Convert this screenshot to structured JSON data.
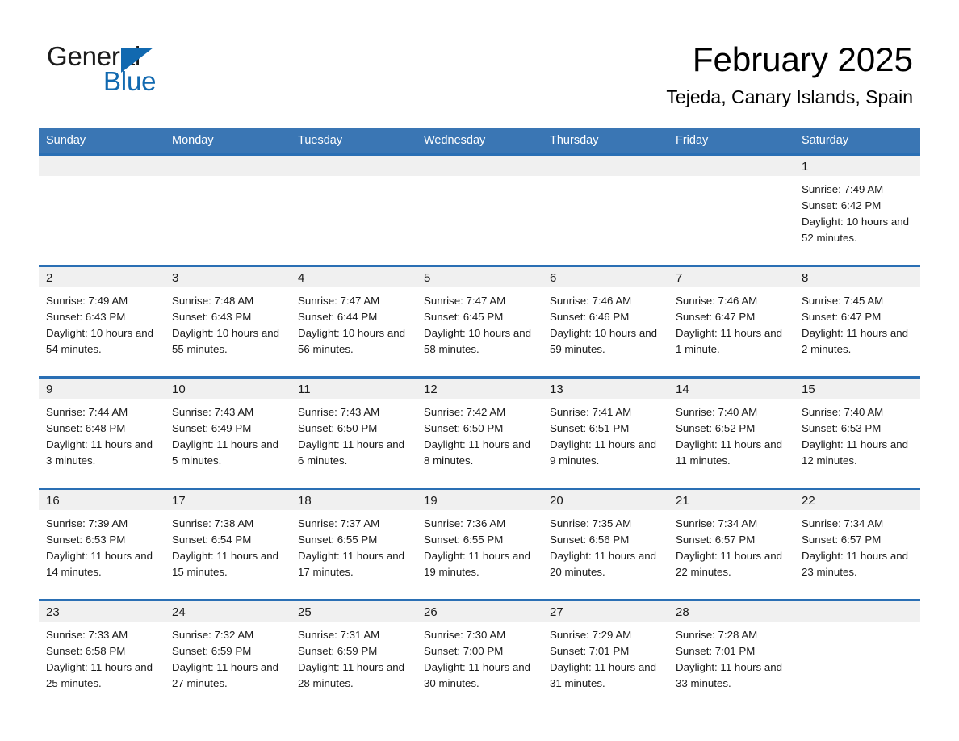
{
  "brand": {
    "name_part1": "General",
    "name_part2": "Blue",
    "triangle_icon": "blue-triangle-logo-mark",
    "accent_color": "#1169b0"
  },
  "header": {
    "month_title": "February 2025",
    "location": "Tejeda, Canary Islands, Spain"
  },
  "theme": {
    "header_blue": "#3a76b4",
    "row_divider_blue": "#2a6fb4",
    "daynum_band_gray": "#f0f0f0",
    "page_background": "#ffffff",
    "text_color": "#1a1a1a"
  },
  "calendar": {
    "weekday_headers": [
      "Sunday",
      "Monday",
      "Tuesday",
      "Wednesday",
      "Thursday",
      "Friday",
      "Saturday"
    ],
    "labels": {
      "sunrise": "Sunrise:",
      "sunset": "Sunset:",
      "daylight": "Daylight:"
    },
    "weeks": [
      [
        {
          "day": ""
        },
        {
          "day": ""
        },
        {
          "day": ""
        },
        {
          "day": ""
        },
        {
          "day": ""
        },
        {
          "day": ""
        },
        {
          "day": "1",
          "sunrise": "Sunrise: 7:49 AM",
          "sunset": "Sunset: 6:42 PM",
          "daylight": "Daylight: 10 hours and 52 minutes."
        }
      ],
      [
        {
          "day": "2",
          "sunrise": "Sunrise: 7:49 AM",
          "sunset": "Sunset: 6:43 PM",
          "daylight": "Daylight: 10 hours and 54 minutes."
        },
        {
          "day": "3",
          "sunrise": "Sunrise: 7:48 AM",
          "sunset": "Sunset: 6:43 PM",
          "daylight": "Daylight: 10 hours and 55 minutes."
        },
        {
          "day": "4",
          "sunrise": "Sunrise: 7:47 AM",
          "sunset": "Sunset: 6:44 PM",
          "daylight": "Daylight: 10 hours and 56 minutes."
        },
        {
          "day": "5",
          "sunrise": "Sunrise: 7:47 AM",
          "sunset": "Sunset: 6:45 PM",
          "daylight": "Daylight: 10 hours and 58 minutes."
        },
        {
          "day": "6",
          "sunrise": "Sunrise: 7:46 AM",
          "sunset": "Sunset: 6:46 PM",
          "daylight": "Daylight: 10 hours and 59 minutes."
        },
        {
          "day": "7",
          "sunrise": "Sunrise: 7:46 AM",
          "sunset": "Sunset: 6:47 PM",
          "daylight": "Daylight: 11 hours and 1 minute."
        },
        {
          "day": "8",
          "sunrise": "Sunrise: 7:45 AM",
          "sunset": "Sunset: 6:47 PM",
          "daylight": "Daylight: 11 hours and 2 minutes."
        }
      ],
      [
        {
          "day": "9",
          "sunrise": "Sunrise: 7:44 AM",
          "sunset": "Sunset: 6:48 PM",
          "daylight": "Daylight: 11 hours and 3 minutes."
        },
        {
          "day": "10",
          "sunrise": "Sunrise: 7:43 AM",
          "sunset": "Sunset: 6:49 PM",
          "daylight": "Daylight: 11 hours and 5 minutes."
        },
        {
          "day": "11",
          "sunrise": "Sunrise: 7:43 AM",
          "sunset": "Sunset: 6:50 PM",
          "daylight": "Daylight: 11 hours and 6 minutes."
        },
        {
          "day": "12",
          "sunrise": "Sunrise: 7:42 AM",
          "sunset": "Sunset: 6:50 PM",
          "daylight": "Daylight: 11 hours and 8 minutes."
        },
        {
          "day": "13",
          "sunrise": "Sunrise: 7:41 AM",
          "sunset": "Sunset: 6:51 PM",
          "daylight": "Daylight: 11 hours and 9 minutes."
        },
        {
          "day": "14",
          "sunrise": "Sunrise: 7:40 AM",
          "sunset": "Sunset: 6:52 PM",
          "daylight": "Daylight: 11 hours and 11 minutes."
        },
        {
          "day": "15",
          "sunrise": "Sunrise: 7:40 AM",
          "sunset": "Sunset: 6:53 PM",
          "daylight": "Daylight: 11 hours and 12 minutes."
        }
      ],
      [
        {
          "day": "16",
          "sunrise": "Sunrise: 7:39 AM",
          "sunset": "Sunset: 6:53 PM",
          "daylight": "Daylight: 11 hours and 14 minutes."
        },
        {
          "day": "17",
          "sunrise": "Sunrise: 7:38 AM",
          "sunset": "Sunset: 6:54 PM",
          "daylight": "Daylight: 11 hours and 15 minutes."
        },
        {
          "day": "18",
          "sunrise": "Sunrise: 7:37 AM",
          "sunset": "Sunset: 6:55 PM",
          "daylight": "Daylight: 11 hours and 17 minutes."
        },
        {
          "day": "19",
          "sunrise": "Sunrise: 7:36 AM",
          "sunset": "Sunset: 6:55 PM",
          "daylight": "Daylight: 11 hours and 19 minutes."
        },
        {
          "day": "20",
          "sunrise": "Sunrise: 7:35 AM",
          "sunset": "Sunset: 6:56 PM",
          "daylight": "Daylight: 11 hours and 20 minutes."
        },
        {
          "day": "21",
          "sunrise": "Sunrise: 7:34 AM",
          "sunset": "Sunset: 6:57 PM",
          "daylight": "Daylight: 11 hours and 22 minutes."
        },
        {
          "day": "22",
          "sunrise": "Sunrise: 7:34 AM",
          "sunset": "Sunset: 6:57 PM",
          "daylight": "Daylight: 11 hours and 23 minutes."
        }
      ],
      [
        {
          "day": "23",
          "sunrise": "Sunrise: 7:33 AM",
          "sunset": "Sunset: 6:58 PM",
          "daylight": "Daylight: 11 hours and 25 minutes."
        },
        {
          "day": "24",
          "sunrise": "Sunrise: 7:32 AM",
          "sunset": "Sunset: 6:59 PM",
          "daylight": "Daylight: 11 hours and 27 minutes."
        },
        {
          "day": "25",
          "sunrise": "Sunrise: 7:31 AM",
          "sunset": "Sunset: 6:59 PM",
          "daylight": "Daylight: 11 hours and 28 minutes."
        },
        {
          "day": "26",
          "sunrise": "Sunrise: 7:30 AM",
          "sunset": "Sunset: 7:00 PM",
          "daylight": "Daylight: 11 hours and 30 minutes."
        },
        {
          "day": "27",
          "sunrise": "Sunrise: 7:29 AM",
          "sunset": "Sunset: 7:01 PM",
          "daylight": "Daylight: 11 hours and 31 minutes."
        },
        {
          "day": "28",
          "sunrise": "Sunrise: 7:28 AM",
          "sunset": "Sunset: 7:01 PM",
          "daylight": "Daylight: 11 hours and 33 minutes."
        },
        {
          "day": ""
        }
      ]
    ]
  }
}
